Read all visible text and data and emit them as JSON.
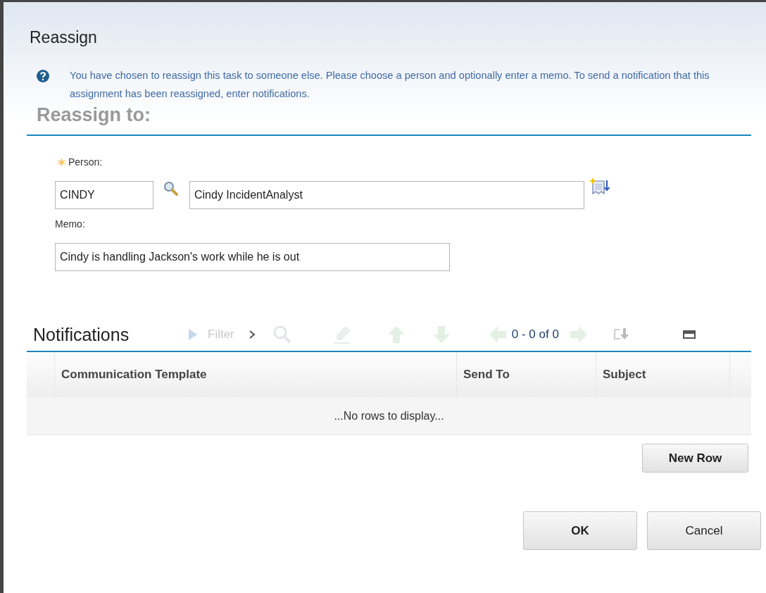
{
  "dialog": {
    "title": "Reassign"
  },
  "info": {
    "text": "You have chosen to reassign this task to someone else. Please choose a person and optionally enter a memo. To send a notification that this assignment has been reassigned, enter notifications."
  },
  "section": {
    "heading": "Reassign to:"
  },
  "person": {
    "label": "Person:",
    "required": true,
    "id_value": "CINDY",
    "name_value": "Cindy IncidentAnalyst"
  },
  "memo": {
    "label": "Memo:",
    "value": "Cindy is handling Jackson's work while he is out"
  },
  "notifications": {
    "title": "Notifications",
    "filter": {
      "label": "Filter",
      "disabled": true
    },
    "paging": "0 - 0 of 0",
    "columns": [
      "Communication Template",
      "Send To",
      "Subject"
    ],
    "empty_message": "...No rows to display...",
    "new_row_button": "New Row"
  },
  "buttons": [
    "OK",
    "Cancel"
  ]
}
